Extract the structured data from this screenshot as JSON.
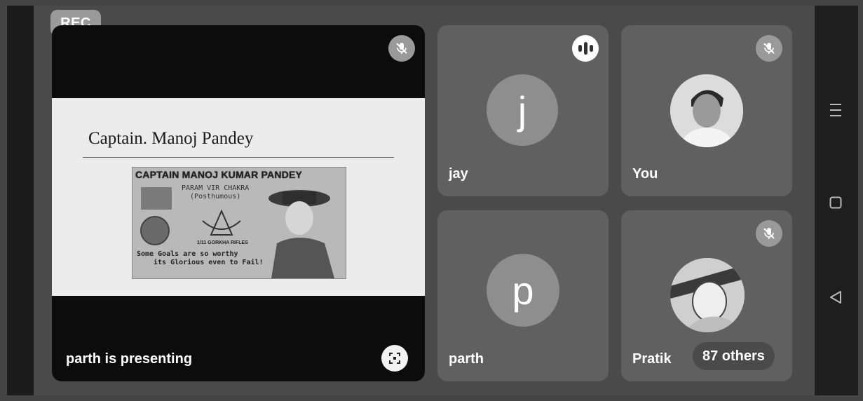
{
  "recording_badge": "REC",
  "presentation": {
    "slide_title": "Captain. Manoj Pandey",
    "poster_heading": "CAPTAIN MANOJ KUMAR PANDEY",
    "poster_award_line1": "PARAM VIR CHAKRA",
    "poster_award_line2": "(Posthumous)",
    "poster_regiment": "1/11 GORKHA RIFLES",
    "poster_quote_line1": "Some Goals are so worthy",
    "poster_quote_line2": "its Glorious even to Fail!",
    "presenting_label": "parth is presenting"
  },
  "participants": [
    {
      "name": "jay",
      "avatar_letter": "j",
      "status": "speaking"
    },
    {
      "name": "You",
      "avatar": "photo",
      "status": "muted"
    },
    {
      "name": "parth",
      "avatar_letter": "p",
      "status": "unmuted"
    },
    {
      "name": "Pratik",
      "avatar": "illustration",
      "status": "muted"
    }
  ],
  "others_count_label": "87 others",
  "icons": {
    "mic_off": "mic-off-icon",
    "speaking": "audio-level-icon",
    "fullscreen": "fullscreen-icon",
    "nav_menu": "menu-icon",
    "nav_home": "square-home-icon",
    "nav_back": "triangle-back-icon"
  }
}
